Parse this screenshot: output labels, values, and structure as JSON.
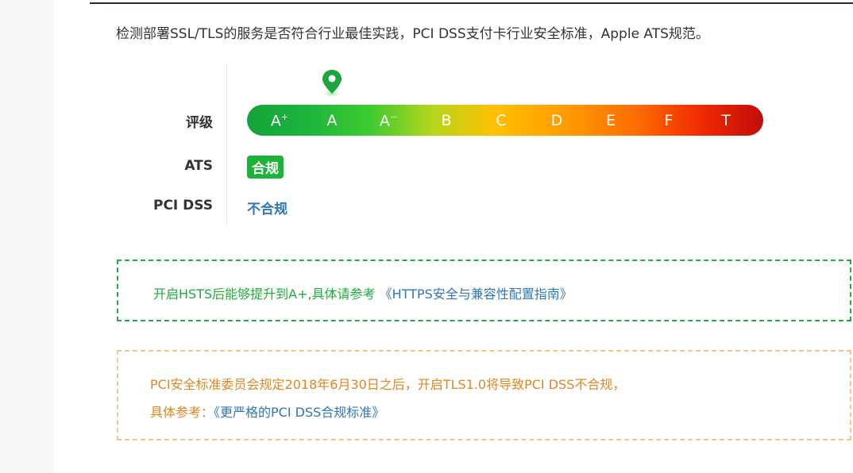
{
  "intro": "检测部署SSL/TLS的服务是否符合行业最佳实践，PCI DSS支付卡行业安全标准，Apple ATS规范。",
  "labels": {
    "grade": "评级",
    "ats": "ATS",
    "pci": "PCI DSS"
  },
  "grades": [
    {
      "base": "A",
      "sup": "+"
    },
    {
      "base": "A",
      "sup": ""
    },
    {
      "base": "A",
      "sup": "−"
    },
    {
      "base": "B",
      "sup": ""
    },
    {
      "base": "C",
      "sup": ""
    },
    {
      "base": "D",
      "sup": ""
    },
    {
      "base": "E",
      "sup": ""
    },
    {
      "base": "F",
      "sup": ""
    },
    {
      "base": "T",
      "sup": ""
    }
  ],
  "current_grade_index": 1,
  "ats_status": "合规",
  "pci_status": "不合规",
  "notice_hsts": {
    "text": "开启HSTS后能够提升到A+,具体请参考 ",
    "link": "《HTTPS安全与兼容性配置指南》"
  },
  "notice_pci": {
    "line1": "PCI安全标准委员会规定2018年6月30日之后，开启TLS1.0将导致PCI DSS不合规，",
    "line2_prefix": "具体参考：",
    "link": "《更严格的PCI DSS合规标准》"
  },
  "colors": {
    "green": "#1cad3c",
    "blue": "#2f77b6",
    "orange": "#e0851f",
    "orange_border": "#f8c48a"
  },
  "icons": {
    "pin": "map-pin-icon"
  }
}
